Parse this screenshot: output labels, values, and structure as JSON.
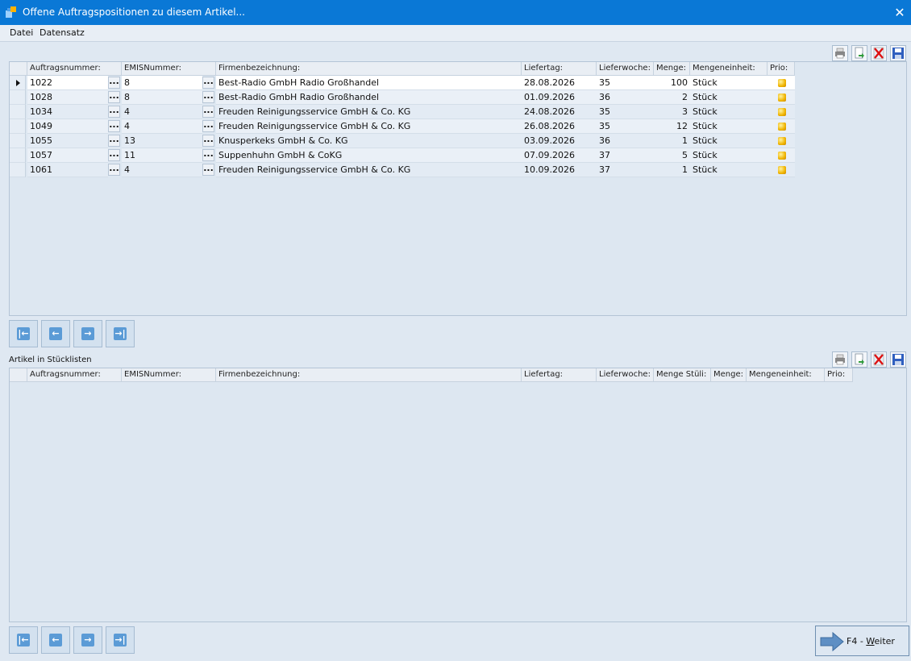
{
  "window": {
    "title": "Offene Auftragspositionen zu diesem Artikel..."
  },
  "menu": {
    "datei": "Datei",
    "datensatz": "Datensatz"
  },
  "grid1": {
    "headers": {
      "auftragsnummer": "Auftragsnummer:",
      "emisnummer": "EMISNummer:",
      "firmenbezeichnung": "Firmenbezeichnung:",
      "liefertag": "Liefertag:",
      "lieferwoche": "Lieferwoche:",
      "menge": "Menge:",
      "mengeneinheit": "Mengeneinheit:",
      "prio": "Prio:"
    },
    "dots": "...",
    "rows": [
      {
        "auftrag": "1022",
        "emis": "8",
        "firma": "Best-Radio GmbH Radio Großhandel",
        "liefertag": "28.08.2026",
        "woche": "35",
        "menge": "100",
        "einheit": "Stück"
      },
      {
        "auftrag": "1028",
        "emis": "8",
        "firma": "Best-Radio GmbH Radio Großhandel",
        "liefertag": "01.09.2026",
        "woche": "36",
        "menge": "2",
        "einheit": "Stück"
      },
      {
        "auftrag": "1034",
        "emis": "4",
        "firma": "Freuden Reinigungsservice GmbH & Co. KG",
        "liefertag": "24.08.2026",
        "woche": "35",
        "menge": "3",
        "einheit": "Stück"
      },
      {
        "auftrag": "1049",
        "emis": "4",
        "firma": "Freuden Reinigungsservice GmbH & Co. KG",
        "liefertag": "26.08.2026",
        "woche": "35",
        "menge": "12",
        "einheit": "Stück"
      },
      {
        "auftrag": "1055",
        "emis": "13",
        "firma": "Knusperkeks GmbH & Co. KG",
        "liefertag": "03.09.2026",
        "woche": "36",
        "menge": "1",
        "einheit": "Stück"
      },
      {
        "auftrag": "1057",
        "emis": "11",
        "firma": "Suppenhuhn GmbH & CoKG",
        "liefertag": "07.09.2026",
        "woche": "37",
        "menge": "5",
        "einheit": "Stück"
      },
      {
        "auftrag": "1061",
        "emis": "4",
        "firma": "Freuden Reinigungsservice GmbH & Co. KG",
        "liefertag": "10.09.2026",
        "woche": "37",
        "menge": "1",
        "einheit": "Stück"
      }
    ]
  },
  "grid2": {
    "section_label": "Artikel in Stücklisten",
    "headers": {
      "auftragsnummer": "Auftragsnummer:",
      "emisnummer": "EMISNummer:",
      "firmenbezeichnung": "Firmenbezeichnung:",
      "liefertag": "Liefertag:",
      "lieferwoche": "Lieferwoche:",
      "menge_stueli": "Menge Stüli:",
      "menge": "Menge:",
      "mengeneinheit": "Mengeneinheit:",
      "prio": "Prio:"
    }
  },
  "buttons": {
    "weiter_prefix": "F4 - ",
    "weiter_key": "W",
    "weiter_rest": "eiter"
  },
  "colors": {
    "titlebar": "#0a78d6",
    "accent": "#5b9bd6"
  }
}
